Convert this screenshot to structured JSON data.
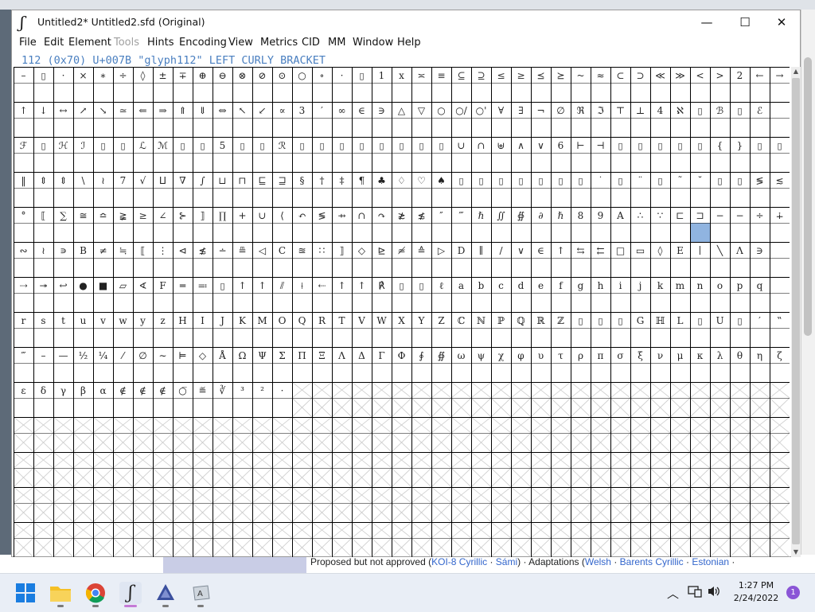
{
  "window": {
    "title": "Untitled2*  Untitled2.sfd (Original)",
    "app_logo": "ʃ",
    "minimize": "—",
    "maximize": "☐",
    "close": "✕"
  },
  "menu": [
    {
      "label": "File",
      "enabled": true
    },
    {
      "label": "Edit",
      "enabled": true
    },
    {
      "label": "Element",
      "enabled": true
    },
    {
      "label": "Tools",
      "enabled": false
    },
    {
      "label": "Hints",
      "enabled": true
    },
    {
      "label": "Encoding",
      "enabled": true
    },
    {
      "label": "View",
      "enabled": true
    },
    {
      "label": "Metrics",
      "enabled": true
    },
    {
      "label": "CID",
      "enabled": true
    },
    {
      "label": "MM",
      "enabled": true
    },
    {
      "label": "Window",
      "enabled": true
    },
    {
      "label": "Help",
      "enabled": true
    }
  ],
  "status_line": "112 (0x70) U+007B \"glyph112\" LEFT CURLY BRACKET",
  "selected_cell": {
    "row": 4,
    "col": 34
  },
  "glyph_rows": [
    [
      "–",
      "▯",
      "·",
      "×",
      "∗",
      "÷",
      "◊",
      "±",
      "∓",
      "⊕",
      "⊖",
      "⊗",
      "⊘",
      "⊙",
      "○",
      "∘",
      "·",
      "▯",
      "1",
      "x",
      "≍",
      "≡",
      "⊆",
      "⊇",
      "≤",
      "≥",
      "⪯",
      "⪰",
      "~",
      "≈",
      "⊂",
      "⊃",
      "≪",
      "≫",
      "<",
      ">",
      "2",
      "←",
      "→"
    ],
    [
      "↑",
      "↓",
      "↔",
      "↗",
      "↘",
      "≃",
      "⇐",
      "⇒",
      "⇑",
      "⇓",
      "⇔",
      "↖",
      "↙",
      "∝",
      "3",
      "′",
      "∞",
      "∈",
      "∋",
      "△",
      "▽",
      "○",
      "○/",
      "○'",
      "∀",
      "∃",
      "¬",
      "∅",
      "ℜ",
      "ℑ",
      "⊤",
      "⊥",
      "4",
      "ℵ",
      "▯",
      "ℬ",
      "▯",
      "ℰ"
    ],
    [
      "ℱ",
      "▯",
      "ℋ",
      "ℐ",
      "▯",
      "▯",
      "ℒ",
      "ℳ",
      "▯",
      "▯",
      "5",
      "▯",
      "▯",
      "ℛ",
      "▯",
      "▯",
      "▯",
      "▯",
      "▯",
      "▯",
      "▯",
      "▯",
      "∪",
      "∩",
      "⊎",
      "∧",
      "∨",
      "6",
      "⊢",
      "⊣",
      "▯",
      "▯",
      "▯",
      "▯",
      "▯",
      "{",
      "}",
      "▯",
      "▯",
      "|"
    ],
    [
      "‖",
      "⇕",
      "⇕",
      "\\",
      "≀",
      "7",
      "√",
      "⨿",
      "∇",
      "∫",
      "⊔",
      "⊓",
      "⊑",
      "⊒",
      "§",
      "†",
      "‡",
      "¶",
      "♣",
      "♢",
      "♡",
      "♠",
      "▯",
      "▯",
      "▯",
      "▯",
      "▯",
      "▯",
      "▯",
      "˙",
      "▯",
      "¨",
      "▯",
      "˜",
      "˘",
      "▯",
      "▯",
      "≶",
      "≲"
    ],
    [
      "°",
      "⟦",
      "∑",
      "≅",
      "≏",
      "≩",
      "≥",
      "∠",
      "⊱",
      "⟧",
      "∏",
      "+",
      "∪",
      "⟨",
      "↶",
      "≶",
      "⇸",
      "∩",
      "↷",
      "≵",
      "≴",
      "″",
      "‴",
      "ℏ",
      "∬",
      "∯",
      "∂",
      "ℏ",
      "8",
      "9",
      "A",
      "∴",
      "∵",
      "⊏",
      "⊐",
      "−",
      "−",
      "÷",
      "∔"
    ],
    [
      "∾",
      "≀",
      "∍",
      "B",
      "≠",
      "≒",
      "⟦",
      "⋮",
      "⊲",
      "≴",
      "∸",
      "≞",
      "◁",
      "C",
      "≊",
      "∷",
      "⟧",
      "◇",
      "⊵",
      "≄",
      "≙",
      "▷",
      "D",
      "∥",
      "/",
      "∨",
      "∈",
      "↑",
      "⇆",
      "⇇",
      "□",
      "▭",
      "◊",
      "E",
      "∣",
      "╲",
      "Λ",
      "∋"
    ],
    [
      "⇢",
      "↠",
      "↩",
      "●",
      "■",
      "▱",
      "∢",
      "F",
      "═",
      "≕",
      "▯",
      "↑",
      "↑",
      "⫽",
      "⟊",
      "⇠",
      "↑",
      "↑",
      "℟",
      "▯",
      "▯",
      "ℓ",
      "a",
      "b",
      "c",
      "d",
      "e",
      "f",
      "g",
      "h",
      "i",
      "j",
      "k",
      "m",
      "n",
      "o",
      "p",
      "q"
    ],
    [
      "r",
      "s",
      "t",
      "u",
      "v",
      "w",
      "y",
      "z",
      "H",
      "I",
      "J",
      "K",
      "M",
      "O",
      "Q",
      "R",
      "T",
      "V",
      "W",
      "X",
      "Y",
      "Z",
      "ℂ",
      "ℕ",
      "ℙ",
      "ℚ",
      "ℝ",
      "ℤ",
      "▯",
      "▯",
      "▯",
      "G",
      "ℍ",
      "L",
      "▯",
      "U",
      "▯",
      "′",
      "‟"
    ],
    [
      "‴",
      "–",
      "—",
      "½",
      "¼",
      "⁄",
      "∅",
      "∼",
      "⊨",
      "◇",
      "Å",
      "Ω",
      "Ψ",
      "Σ",
      "Π",
      "Ξ",
      "Λ",
      "Δ",
      "Γ",
      "Φ",
      "∮",
      "∯",
      "ω",
      "ψ",
      "χ",
      "φ",
      "υ",
      "τ",
      "ρ",
      "π",
      "σ",
      "ξ",
      "ν",
      "μ",
      "κ",
      "λ",
      "θ",
      "η",
      "ζ"
    ],
    [
      "ε",
      "δ",
      "γ",
      "β",
      "α",
      "∉",
      "∉",
      "∉",
      "○̅",
      "≝",
      "∛",
      "³",
      "²",
      "·"
    ]
  ],
  "total_rows": 14,
  "cols": 39,
  "background": {
    "footer_text_prefix": "Proposed but not approved (",
    "footer_link1": "KOI-8 Cyrillic",
    "footer_sep1": " · ",
    "footer_link2": "Sámi",
    "footer_mid": ") · Adaptations (",
    "footer_link3": "Welsh",
    "footer_sep2": " · ",
    "footer_link4": "Barents Cyrillic",
    "footer_sep3": " · ",
    "footer_link5": "Estonian",
    "footer_suffix": " ·"
  },
  "taskbar": {
    "time": "1:27 PM",
    "date": "2/24/2022",
    "notification_count": "1",
    "tray_chevron": "︿"
  },
  "colors": {
    "status_text": "#4a7fc0",
    "selected": "#90b4e0",
    "grid_line": "#000000",
    "empty_cross": "#c8c8c8"
  }
}
